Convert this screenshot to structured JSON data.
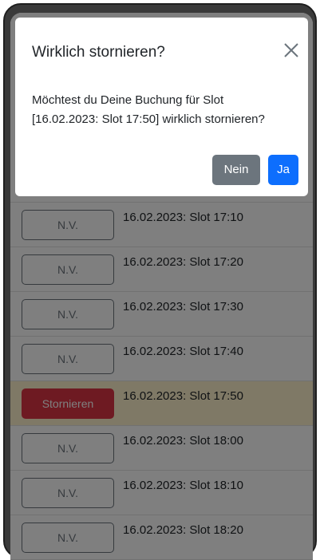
{
  "colors": {
    "primary": "#0d6efd",
    "secondary": "#6c757d",
    "danger": "#dc3545",
    "highlight_row": "#fff3cd"
  },
  "modal": {
    "title": "Wirklich stornieren?",
    "body_line1": "Möchtest du Deine Buchung für Slot",
    "body_line2": "[16.02.2023: Slot 17:50] wirklich stornieren?",
    "cancel_label": "Nein",
    "confirm_label": "Ja",
    "close_icon": "close-icon"
  },
  "slots": [
    {
      "button_label": "N.V.",
      "text": "16.02.2023: Slot 17:10"
    },
    {
      "button_label": "N.V.",
      "text": "16.02.2023: Slot 17:20"
    },
    {
      "button_label": "N.V.",
      "text": "16.02.2023: Slot 17:30"
    },
    {
      "button_label": "N.V.",
      "text": "16.02.2023: Slot 17:40"
    },
    {
      "button_label": "Stornieren",
      "text": "16.02.2023: Slot 17:50"
    },
    {
      "button_label": "N.V.",
      "text": "16.02.2023: Slot 18:00"
    },
    {
      "button_label": "N.V.",
      "text": "16.02.2023: Slot 18:10"
    },
    {
      "button_label": "N.V.",
      "text": "16.02.2023: Slot 18:20"
    }
  ]
}
